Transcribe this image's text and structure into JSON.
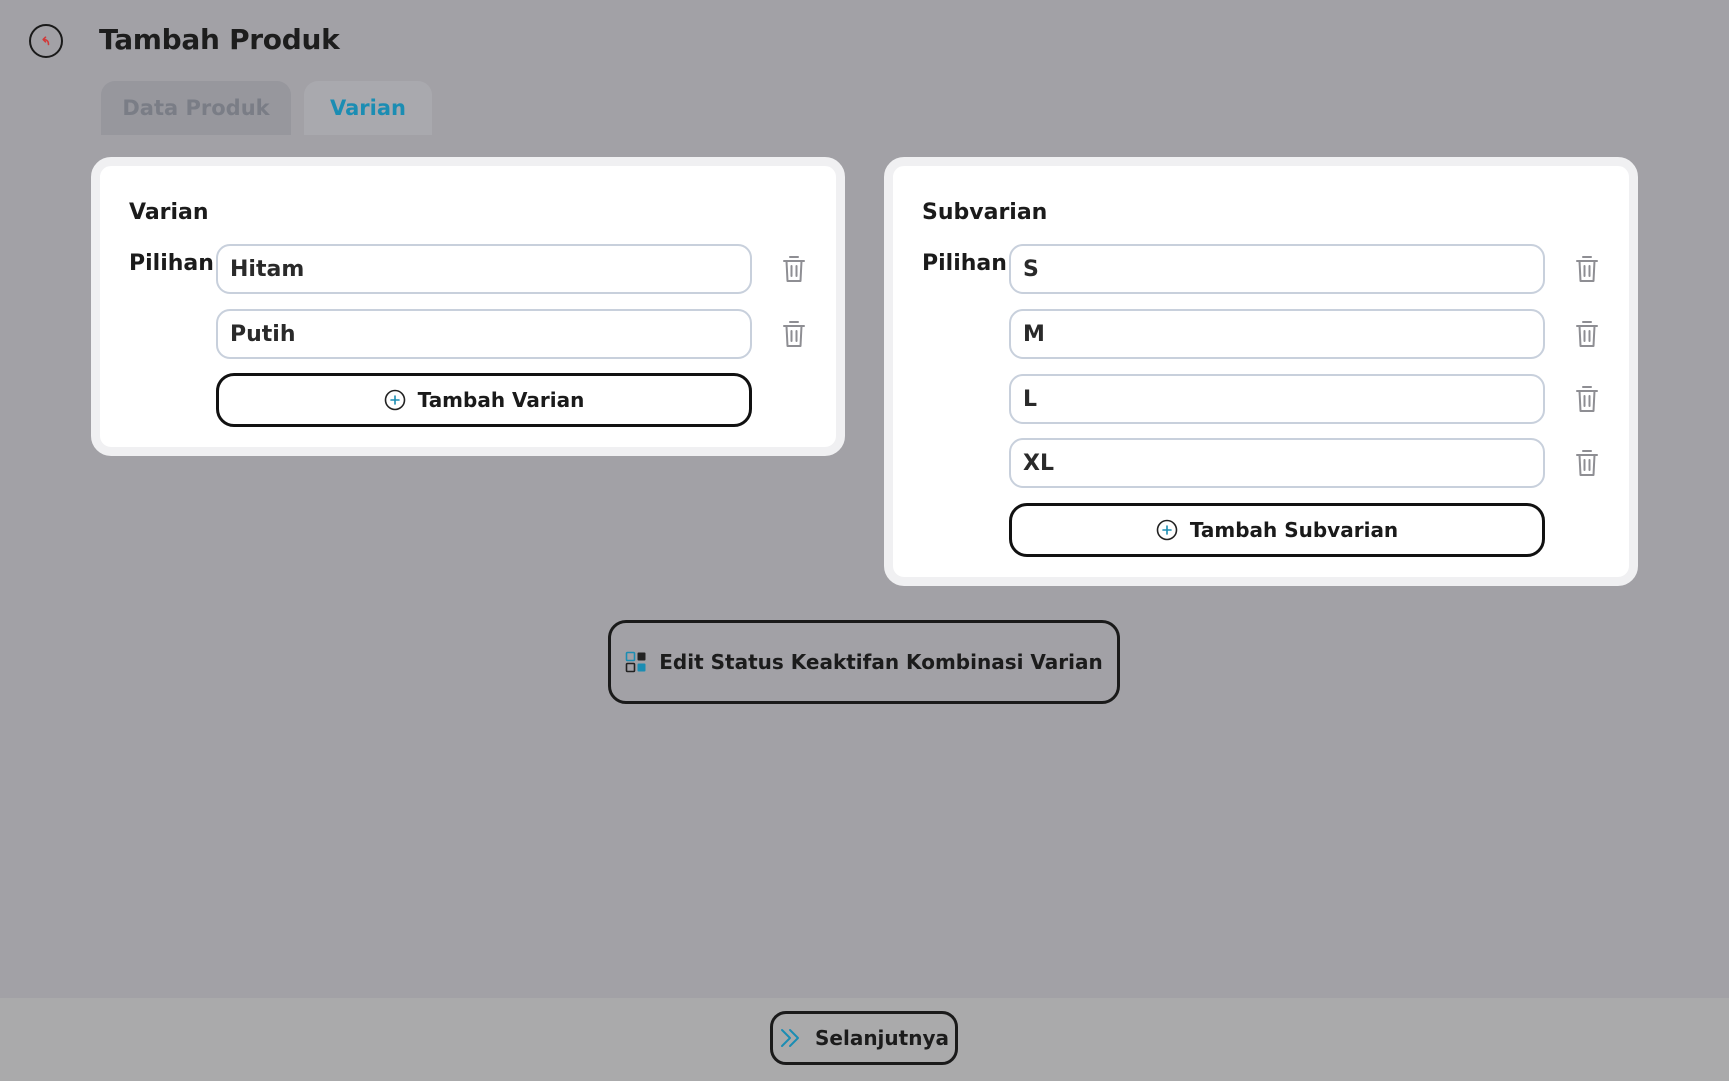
{
  "header": {
    "title": "Tambah Produk",
    "back_icon": "back-arrow-circle-icon"
  },
  "tabs": [
    {
      "label": "Data Produk",
      "active": false
    },
    {
      "label": "Varian",
      "active": true
    }
  ],
  "varian": {
    "title": "Varian",
    "pilihan_label": "Pilihan",
    "options": [
      "Hitam",
      "Putih"
    ],
    "add_label": "Tambah Varian"
  },
  "subvarian": {
    "title": "Subvarian",
    "pilihan_label": "Pilihan",
    "options": [
      "S",
      "M",
      "L",
      "XL"
    ],
    "add_label": "Tambah Subvarian"
  },
  "edit_status": {
    "label": "Edit Status Keaktifan Kombinasi Varian"
  },
  "footer": {
    "next_label": "Selanjutnya"
  },
  "colors": {
    "accent": "#1b8db3",
    "back_icon": "#d23a3a",
    "background": "#a2a1a6"
  }
}
